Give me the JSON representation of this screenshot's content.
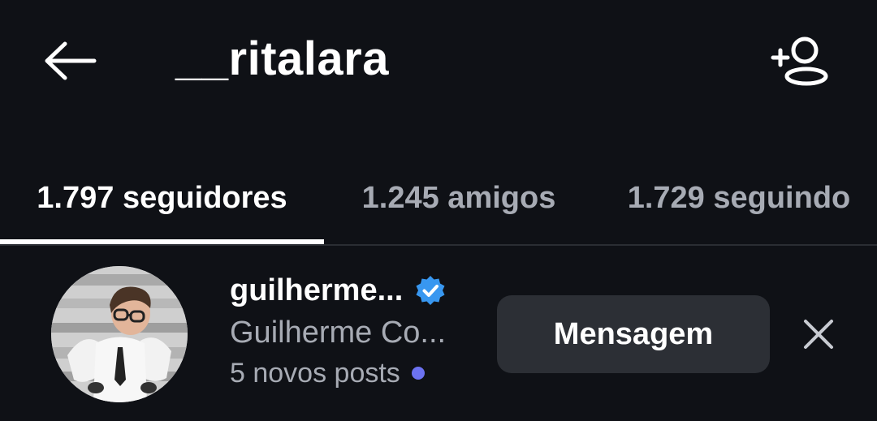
{
  "header": {
    "title": "__ritalara",
    "back_icon": "arrow-left-icon",
    "add_friend_icon": "add-person-icon"
  },
  "tabs": [
    {
      "label": "1.797 seguidores",
      "active": true
    },
    {
      "label": "1.245 amigos",
      "active": false
    },
    {
      "label": "1.729 seguindo",
      "active": false
    }
  ],
  "list": {
    "items": [
      {
        "username": "guilherme...",
        "full_name": "Guilherme Co...",
        "posts": "5 novos posts",
        "verified": true,
        "message_label": "Mensagem",
        "close_icon": "close-icon"
      }
    ]
  },
  "colors": {
    "background": "#0f1116",
    "text_primary": "#ffffff",
    "text_secondary": "#a7abb4",
    "button_bg": "#2c2f35",
    "verified_blue": "#3897f0",
    "new_posts_dot": "#6c72f1"
  }
}
